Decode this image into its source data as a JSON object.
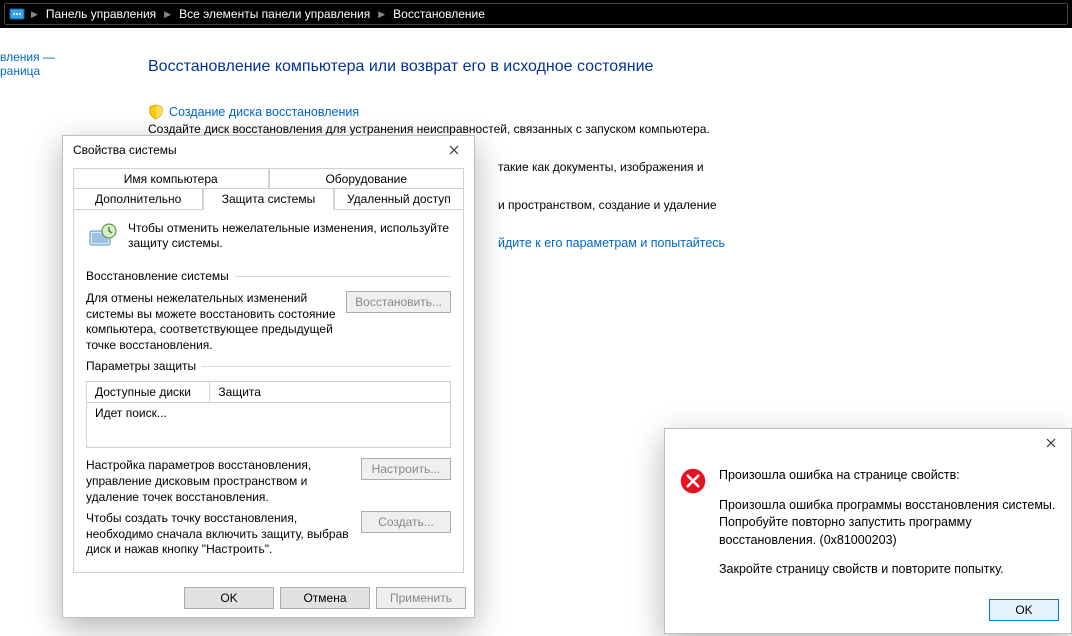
{
  "addressbar": {
    "crumbs": [
      "Панель управления",
      "Все элементы панели управления",
      "Восстановление"
    ]
  },
  "leftpane": {
    "line1": "вления —",
    "line2": "раница"
  },
  "main": {
    "title": "Восстановление компьютера или возврат его в исходное состояние",
    "link1": "Создание диска восстановления",
    "desc1": "Создайте диск восстановления для устранения неисправностей, связанных с запуском компьютера.",
    "partial1": "такие как документы, изображения и",
    "partial2": "и пространством, создание и удаление",
    "link2": "йдите к его параметрам и попытайтесь"
  },
  "sysdlg": {
    "title": "Свойства системы",
    "tabs": {
      "row1": [
        "Имя компьютера",
        "Оборудование"
      ],
      "row2": [
        "Дополнительно",
        "Защита системы",
        "Удаленный доступ"
      ]
    },
    "info": "Чтобы отменить нежелательные изменения, используйте защиту системы.",
    "group_restore": "Восстановление системы",
    "restore_text": "Для отмены нежелательных изменений системы вы можете восстановить состояние компьютера, соответствующее предыдущей точке восстановления.",
    "btn_restore": "Восстановить...",
    "group_params": "Параметры защиты",
    "table": {
      "col1": "Доступные диски",
      "col2": "Защита",
      "searching": "Идет поиск..."
    },
    "config_text": "Настройка параметров восстановления, управление дисковым пространством и удаление точек восстановления.",
    "btn_config": "Настроить...",
    "create_text": "Чтобы создать точку восстановления, необходимо сначала включить защиту, выбрав диск и нажав кнопку \"Настроить\".",
    "btn_create": "Создать...",
    "btn_ok": "OK",
    "btn_cancel": "Отмена",
    "btn_apply": "Применить"
  },
  "errdlg": {
    "line1": "Произошла ошибка на странице свойств:",
    "line2": "Произошла ошибка программы восстановления системы. Попробуйте повторно запустить программу восстановления. (0x81000203)",
    "line3": "Закройте страницу свойств и повторите попытку.",
    "btn_ok": "OK"
  }
}
